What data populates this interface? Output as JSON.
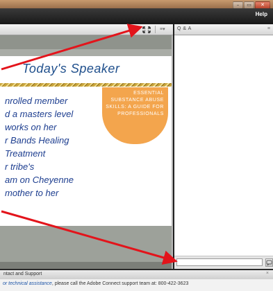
{
  "window": {
    "controls": [
      "–",
      "▭",
      "✕"
    ]
  },
  "menubar": {
    "help_label": "Help"
  },
  "share_pod": {
    "fullscreen_icon": "fullscreen-icon",
    "menu_icon": "≡▾"
  },
  "slide": {
    "title": "Today's Speaker",
    "lines": [
      "nrolled member",
      "d a masters level",
      "works on her",
      "r Bands Healing",
      "Treatment",
      "r tribe's",
      "am on Cheyenne",
      "mother to her"
    ],
    "badge_lines": [
      "ESSENTIAL",
      "SUBSTANCE ABUSE",
      "SKILLS: A GUIDE FOR",
      "PROFESSIONALS"
    ]
  },
  "qa_pod": {
    "title": "Q & A",
    "menu_icon": "≡",
    "input_value": "",
    "send_icon": "send-icon"
  },
  "contact": {
    "title": "ntact and Support",
    "close_icon": "×",
    "text_emphasis": "or technical assistance",
    "text_rest": ", please call the Adobe Connect support team at: 800-422-3623"
  },
  "colors": {
    "arrow": "#e3141b",
    "slide_title": "#1f4f8c",
    "slide_text": "#1c3d8f",
    "badge": "#f3a54d"
  }
}
